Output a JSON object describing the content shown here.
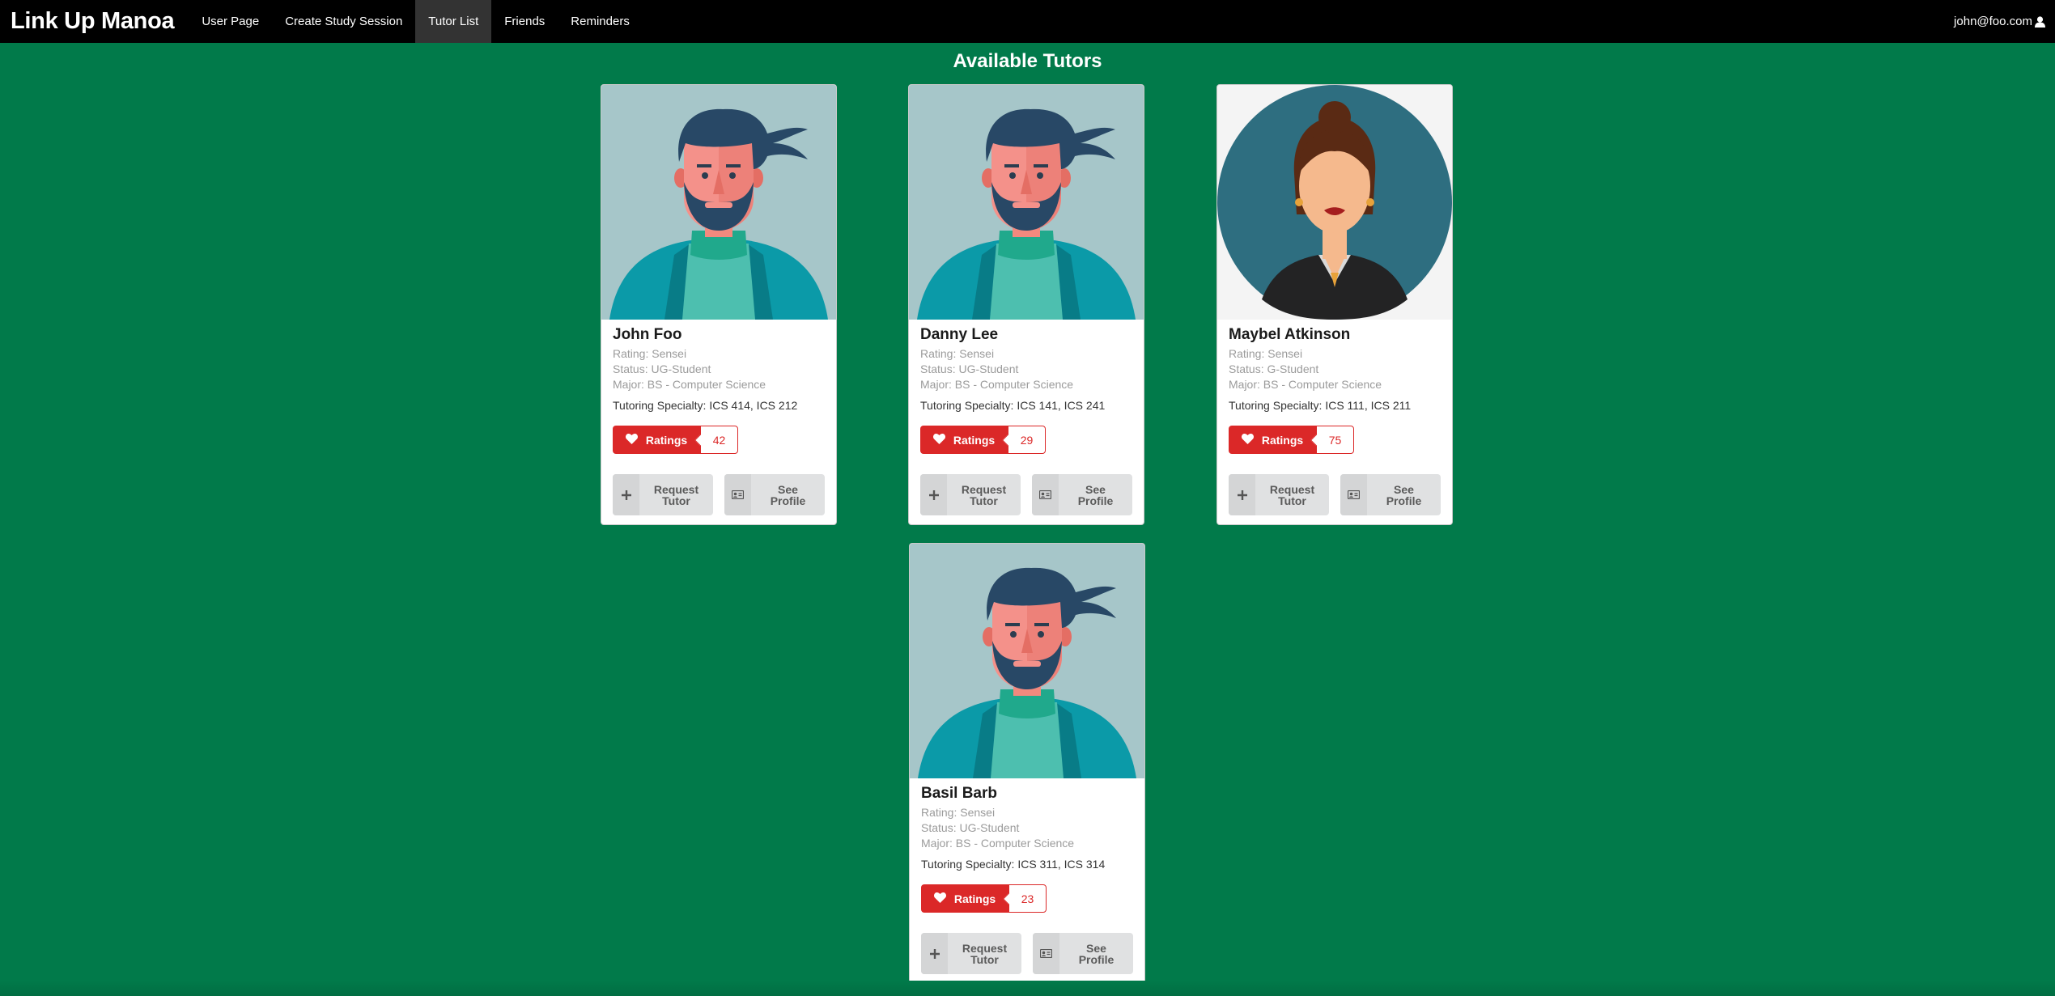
{
  "navbar": {
    "brand": "Link Up Manoa",
    "items": [
      {
        "label": "User Page"
      },
      {
        "label": "Create Study Session"
      },
      {
        "label": "Tutor List"
      },
      {
        "label": "Friends"
      },
      {
        "label": "Reminders"
      }
    ],
    "active_item": "Tutor List",
    "user_email": "john@foo.com",
    "user_icon": "user-icon"
  },
  "page": {
    "title": "Available Tutors"
  },
  "tutors": [
    {
      "name": "John Foo",
      "rating": "Rating: Sensei",
      "status": "Status: UG-Student",
      "major": "Major: BS - Computer Science",
      "specialty": "Tutoring Specialty: ICS 414, ICS 212",
      "ratings_label": "Ratings",
      "ratings_count": "42",
      "request_line1": "Request",
      "request_line2": "Tutor",
      "profile_line1": "See",
      "profile_line2": "Profile",
      "avatar": "male-avatar"
    },
    {
      "name": "Danny Lee",
      "rating": "Rating: Sensei",
      "status": "Status: UG-Student",
      "major": "Major: BS - Computer Science",
      "specialty": "Tutoring Specialty: ICS 141, ICS 241",
      "ratings_label": "Ratings",
      "ratings_count": "29",
      "request_line1": "Request",
      "request_line2": "Tutor",
      "profile_line1": "See",
      "profile_line2": "Profile",
      "avatar": "male-avatar"
    },
    {
      "name": "Maybel Atkinson",
      "rating": "Rating: Sensei",
      "status": "Status: G-Student",
      "major": "Major: BS - Computer Science",
      "specialty": "Tutoring Specialty: ICS 111, ICS 211",
      "ratings_label": "Ratings",
      "ratings_count": "75",
      "request_line1": "Request",
      "request_line2": "Tutor",
      "profile_line1": "See",
      "profile_line2": "Profile",
      "avatar": "female-avatar"
    },
    {
      "name": "Basil Barb",
      "rating": "Rating: Sensei",
      "status": "Status: UG-Student",
      "major": "Major: BS - Computer Science",
      "specialty": "Tutoring Specialty: ICS 311, ICS 314",
      "ratings_label": "Ratings",
      "ratings_count": "23",
      "request_line1": "Request",
      "request_line2": "Tutor",
      "profile_line1": "See",
      "profile_line2": "Profile",
      "avatar": "male-avatar"
    }
  ],
  "colors": {
    "background": "#017a4a",
    "navbar": "#000000",
    "ratings_red": "#db2828",
    "button_grey": "#e0e1e2"
  }
}
